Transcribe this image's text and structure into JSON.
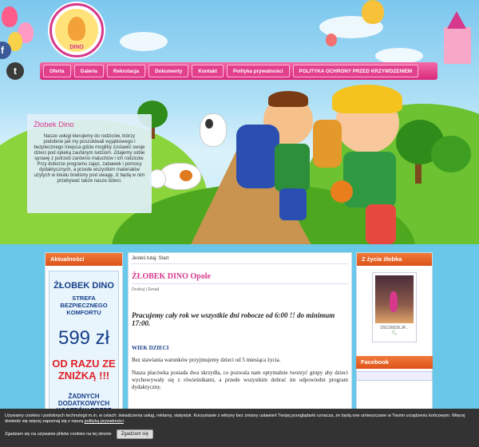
{
  "logo": {
    "text": "DINO"
  },
  "social": {
    "facebook": "f",
    "twitter": "t"
  },
  "nav": {
    "items": [
      "Oferta",
      "Galeria",
      "Rekrutacja",
      "Dokumenty",
      "Kontakt",
      "Polityka prywatności",
      "POLITYKA OCHRONY PRZED KRZYWDZENIEM"
    ]
  },
  "intro": {
    "title": "Żłobek Dino",
    "text": "Nasze usługi kierujemy do rodziców, którzy podobnie jak my poszukiwali wyjątkowego i bezpiecznego miejsca gdzie mogliby zostawić swoje dzieci pod opieką zaufanym ludziom. Zdajemy sobie sprawę z potrzeb zarówno maluchów i ich rodziców. Przy doborze programu zajęć, zabawek i pomocy dydaktycznych, a przede wszystkim materiałów użytych w lokalu braliśmy pod uwagę, iż będą w nim przebywać także nasze dzieci."
  },
  "left": {
    "heading": "Aktualności",
    "ad": {
      "line1": "ŻŁOBEK DINO",
      "line2": "STREFA BEZPIECZNEGO KOMFORTU",
      "price": "599 zł",
      "line3": "OD RAZU ZE ZNIŻKĄ !!!",
      "line4": "ŻADNYCH DODATKOWYCH KOSZTÓW PRZEZ"
    }
  },
  "main": {
    "breadcrumb": "Jesteś tutaj: Start",
    "title": "ŻŁOBEK DINO Opole",
    "tools": "Drukuj | Email",
    "lead": "Pracujemy cały rok we wszystkie dni robocze od 6:00 !! do minimum 17:00.",
    "section": "WIEK DZIECI",
    "para1": "Bez stawiania warunków przyjmujemy dzieci od 5 miesiąca życia.",
    "para2": "Nasza placówka posiada dwa skrzydła, co pozwala nam optymalnie tworzyć grupy aby dzieci wychowywały się z rówieśnikami, a przede wszystkim dobrać im odpowiedni program dydaktyczny."
  },
  "right": {
    "heading": "Z życia żłobka",
    "photo_caption": "DSC00039.JP...",
    "facebook_heading": "Facebook"
  },
  "cookie": {
    "text": "Używamy cookies i podobnych technologii m.in. w celach: świadczenia usług, reklamy, statystyk. Korzystanie z witryny bez zmiany ustawień Twojej przeglądarki oznacza, że będą one umieszczane w Twoim urządzeniu końcowym. Więcej dowiedz się więcej zapoznaj się z naszą",
    "link": "polityką prywatności",
    "agree_text": "Zgadzam się na używanie plików cookies na tej stronie",
    "button": "Zgadzam się"
  },
  "colors": {
    "pink": "#d6388c",
    "orange": "#de531a",
    "navy": "#173f8a",
    "red": "#e21f26"
  }
}
